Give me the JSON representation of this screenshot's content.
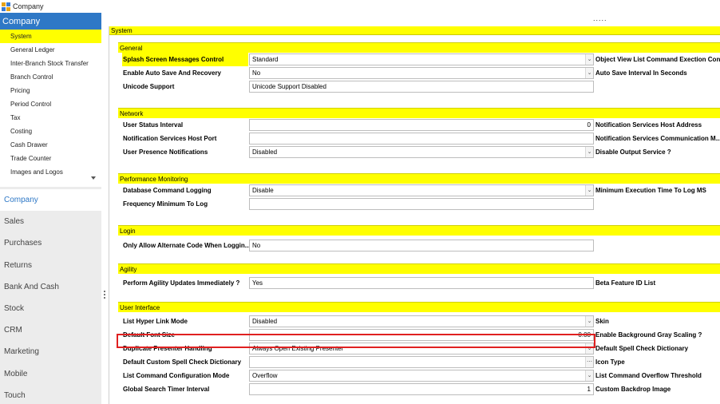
{
  "window": {
    "title": "Company"
  },
  "sidebar": {
    "header": "Company",
    "sub_items": [
      {
        "label": "System",
        "active": true
      },
      {
        "label": "General Ledger"
      },
      {
        "label": "Inter-Branch Stock Transfer"
      },
      {
        "label": "Branch Control"
      },
      {
        "label": "Pricing"
      },
      {
        "label": "Period Control"
      },
      {
        "label": "Tax"
      },
      {
        "label": "Costing"
      },
      {
        "label": "Cash Drawer"
      },
      {
        "label": "Trade Counter"
      },
      {
        "label": "Images and Logos"
      }
    ],
    "modules": [
      {
        "label": "Company",
        "active": true
      },
      {
        "label": "Sales"
      },
      {
        "label": "Purchases"
      },
      {
        "label": "Returns"
      },
      {
        "label": "Bank And Cash"
      },
      {
        "label": "Stock"
      },
      {
        "label": "CRM"
      },
      {
        "label": "Marketing"
      },
      {
        "label": "Mobile"
      },
      {
        "label": "Touch"
      }
    ]
  },
  "main": {
    "dots": ".....",
    "section_title": "System",
    "groups": {
      "general": {
        "title": "General",
        "rows": [
          {
            "label": "Splash Screen Messages Control",
            "value": "Standard",
            "right": "Object View List Command Exection Con..."
          },
          {
            "label": "Enable Auto Save And Recovery",
            "value": "No",
            "right": "Auto Save Interval In Seconds"
          },
          {
            "label": "Unicode Support",
            "value": "Unicode Support Disabled",
            "right": ""
          }
        ]
      },
      "network": {
        "title": "Network",
        "rows": [
          {
            "label": "User Status Interval",
            "value": "0",
            "right": "Notification Services Host Address"
          },
          {
            "label": "Notification Services Host Port",
            "value": "",
            "right": "Notification Services Communication M..."
          },
          {
            "label": "User Presence Notifications",
            "value": "Disabled",
            "right": "Disable Output Service ?"
          }
        ]
      },
      "performance": {
        "title": "Performance Monitoring",
        "rows": [
          {
            "label": "Database Command Logging",
            "value": "Disable",
            "right": "Minimum Execution Time To Log MS"
          },
          {
            "label": "Frequency Minimum To Log",
            "value": "",
            "right": ""
          }
        ]
      },
      "login": {
        "title": "Login",
        "rows": [
          {
            "label": "Only Allow Alternate Code When Loggin...",
            "value": "No",
            "right": ""
          }
        ]
      },
      "agility": {
        "title": "Agility",
        "rows": [
          {
            "label": "Perform Agility Updates Immediately ?",
            "value": "Yes",
            "right": "Beta Feature ID List"
          }
        ]
      },
      "ui": {
        "title": "User Interface",
        "rows": [
          {
            "label": "List Hyper Link Mode",
            "value": "Disabled",
            "right": "Skin"
          },
          {
            "label": "Default Font Size",
            "value": "0.00",
            "right": "Enable Background Gray Scaling ?"
          },
          {
            "label": "Duplicate Presenter Handling",
            "value": "Always Open Existing Presenter",
            "right": "Default Spell Check Dictionary"
          },
          {
            "label": "Default Custom Spell Check Dictionary",
            "value": "",
            "right": "Icon Type"
          },
          {
            "label": "List Command Configuration Mode",
            "value": "Overflow",
            "right": "List Command Overflow Threshold"
          },
          {
            "label": "Global Search Timer Interval",
            "value": "1",
            "right": "Custom Backdrop Image"
          }
        ]
      }
    }
  },
  "icons": {
    "dropdown": "chevron-down-icon",
    "ellipsis": "ellipsis-icon"
  },
  "colors": {
    "accent": "#2e78c6",
    "highlight": "#ffff00",
    "focus": "#e02020"
  }
}
